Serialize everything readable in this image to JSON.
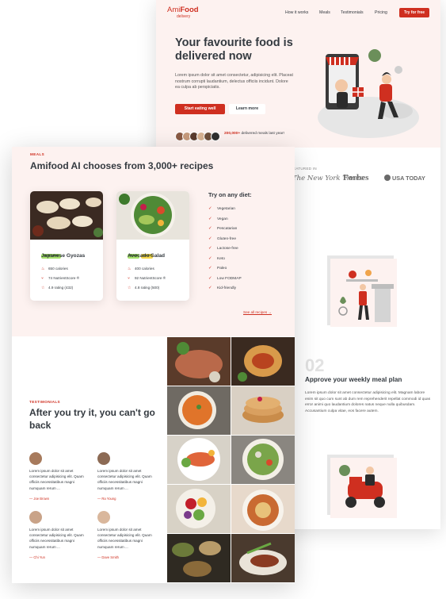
{
  "brand": {
    "name_part1": "Ami",
    "name_part2": "Food",
    "tagline": "delivery",
    "accent": "#cf2f20",
    "bg_tint": "#fdf2f0"
  },
  "nav": {
    "items": [
      "How it works",
      "Meals",
      "Testimonials",
      "Pricing"
    ],
    "cta": "Try for free"
  },
  "hero": {
    "title": "Your favourite food is delivered now",
    "description": "Lorem ipsum dolor sit amet consectetur, adipisicing elit. Placeat nostrum corrupti laudantium, delectus officiis incidunt. Dolore ea culpa ab perspiciatis.",
    "primary_button": "Start eating well",
    "secondary_button": "Learn more",
    "meals_count": "200,000+",
    "meals_suffix": " delivered meals last year!"
  },
  "featured": {
    "label": "FEATURED IN",
    "logos": [
      "The New York Times",
      "Forbes",
      "USA TODAY"
    ]
  },
  "how_it_works": {
    "step_number": "02",
    "step_title": "Approve your weekly meal plan",
    "step_description": "Lorem ipsum dolor sit amet consectetur adipisicing elit. Magnam labore enim sit quo cum sunt ab dum rem reprehenderit repellat commodi id quas error animi quo laudantium dolores natus neque nulla quibusdam. Accusantium culpa vitae, eos facere autem."
  },
  "meals": {
    "label": "MEALS",
    "title": "Amifood AI chooses from 3,000+ recipes",
    "cards": [
      {
        "tags": [
          "VEGETARIAN"
        ],
        "name": "Japanese Gyozas",
        "calories": "650 calories",
        "score": "74 NutrientScore ®",
        "rating": "4.9 rating (432)"
      },
      {
        "tags": [
          "VEGAN",
          "PALEO"
        ],
        "name": "Avocado Salad",
        "calories": "400 calories",
        "score": "92 NutrientScore ®",
        "rating": "4.8 rating (500)"
      }
    ],
    "diet_title": "Try on any diet:",
    "diets": [
      "Vegetarian",
      "Vegan",
      "Pescatarian",
      "Gluten-free",
      "Lactose-free",
      "Keto",
      "Paleo",
      "Low FODMAP",
      "Kid-friendly"
    ],
    "see_all": "See all recipes →"
  },
  "testimonials": {
    "label": "TESTIMONIALS",
    "title": "After you try it, you can't go back",
    "items": [
      {
        "quote": "Lorem ipsum dolor sit amet consectetur adipisicing elit. Quam officiis necessitatibus magni numquam rerum ...",
        "author": "— Joe Brown"
      },
      {
        "quote": "Lorem ipsum dolor sit amet consectetur adipisicing elit. Quam officiis necessitatibus magni numquam rerum ...",
        "author": "— Ra Young"
      },
      {
        "quote": "Lorem ipsum dolor sit amet consectetur adipisicing elit. Quam officiis necessitatibus magni numquam rerum ...",
        "author": "— Chi Yun"
      },
      {
        "quote": "Lorem ipsum dolor sit amet consectetur adipisicing elit. Quam officiis necessitatibus magni numquam rerum ...",
        "author": "— Dave Smith"
      }
    ]
  }
}
